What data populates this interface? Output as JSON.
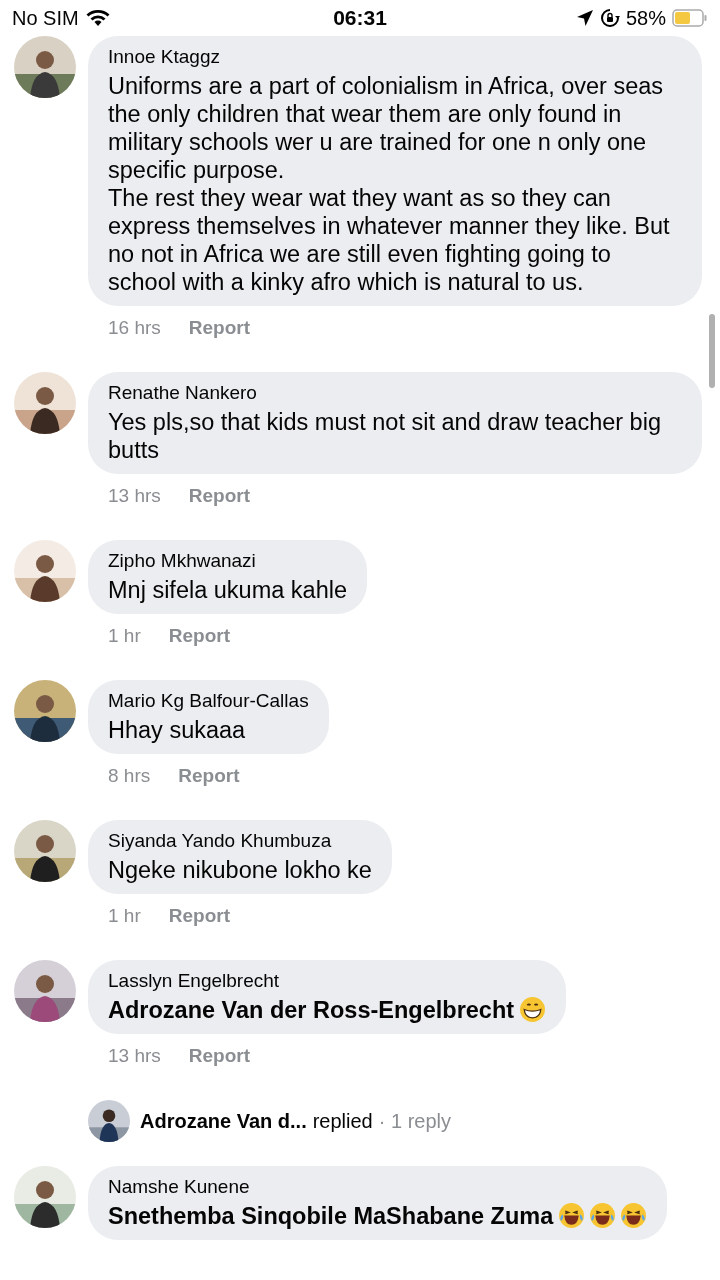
{
  "status_bar": {
    "carrier": "No SIM",
    "time": "06:31",
    "battery": "58%"
  },
  "comments": [
    {
      "name": "Innoe Ktaggz",
      "text": "Uniforms are a part of colonialism in Africa, over seas the only children that wear them are only found in military schools wer u are trained for one n only one specific purpose.\nThe rest they wear wat they want as so they can express themselves in whatever manner they like. But no not in Africa we are still even fighting going to school with a kinky afro which is natural to us.",
      "kind": "plain",
      "time": "16 hrs",
      "action": "Report"
    },
    {
      "name": "Renathe Nankero",
      "text": "Yes pls,so that kids must not sit and draw teacher big butts",
      "kind": "plain",
      "time": "13 hrs",
      "action": "Report"
    },
    {
      "name": "Zipho Mkhwanazi",
      "text": "Mnj sifela ukuma kahle",
      "kind": "plain",
      "time": "1 hr",
      "action": "Report"
    },
    {
      "name": "Mario Kg Balfour-Callas",
      "text": "Hhay sukaaa",
      "kind": "plain",
      "time": "8 hrs",
      "action": "Report"
    },
    {
      "name": "Siyanda Yando Khumbuza",
      "text": "Ngeke nikubone lokho ke",
      "kind": "plain",
      "time": "1 hr",
      "action": "Report"
    },
    {
      "name": "Lasslyn Engelbrecht",
      "text": "Adrozane Van der Ross-Engelbrecht",
      "kind": "mention",
      "emoji": [
        {
          "kind": "grin"
        }
      ],
      "time": "13 hrs",
      "action": "Report",
      "reply": {
        "name": "Adrozane Van d...",
        "verb": "replied",
        "count": "· 1 reply"
      }
    },
    {
      "name": "Namshe Kunene",
      "text": "Snethemba Sinqobile MaShabane Zuma",
      "kind": "mention",
      "emoji": [
        {
          "kind": "laugh"
        },
        {
          "kind": "laugh"
        },
        {
          "kind": "laugh"
        }
      ]
    }
  ]
}
